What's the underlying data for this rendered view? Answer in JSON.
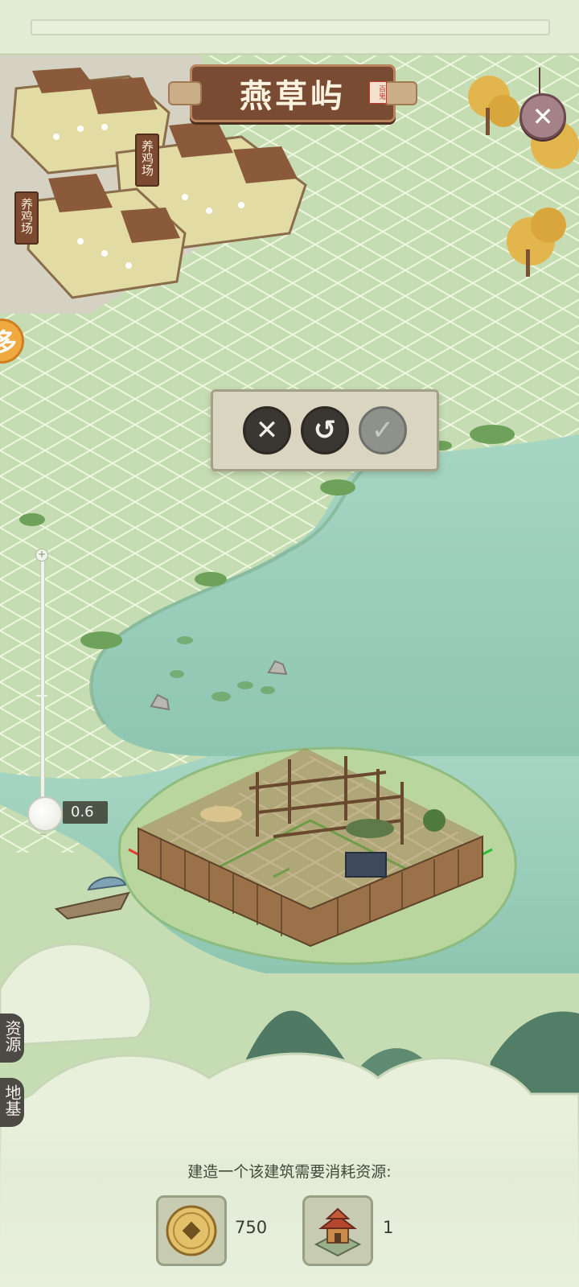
{
  "header": {
    "title": "燕草屿",
    "seal_text": "百鬼"
  },
  "buildings": {
    "sign_1": "养鸡场",
    "sign_2": "养鸡场"
  },
  "left_orb": {
    "glyph": "多"
  },
  "actions": {
    "cancel_glyph": "✕",
    "undo_glyph": "↺",
    "confirm_glyph": "✓",
    "confirm_enabled": false
  },
  "zoom": {
    "plus": "+",
    "minus": "−",
    "value_label": "0.6",
    "level": 0.6
  },
  "side_tabs": {
    "resources": "资源",
    "foundation": "地基"
  },
  "cost": {
    "title": "建造一个该建筑需要消耗资源:",
    "items": [
      {
        "icon": "coin-icon",
        "amount": "750"
      },
      {
        "icon": "building-icon",
        "amount": "1"
      }
    ]
  },
  "close": {
    "glyph": "✕"
  },
  "colors": {
    "grass": "#cfe2bf",
    "grid_line": "#e9f3d2",
    "water": "#9fd1bd",
    "plaque": "#7a4b33",
    "valid_outline": "#2bbd3a",
    "invalid_outline": "#e23b2e"
  }
}
